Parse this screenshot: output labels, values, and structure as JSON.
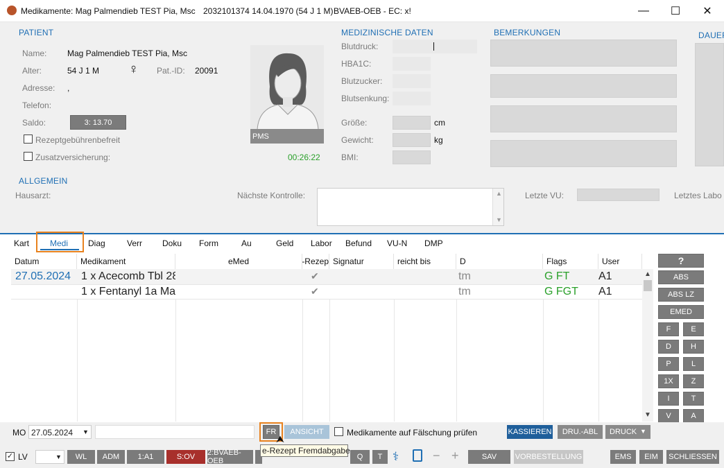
{
  "window": {
    "title": "Medikamente: Mag Palmendieb TEST Pia, Msc",
    "patient_info": "2032101374 14.04.1970 (54 J 1 M)",
    "insurance": "BVAEB-OEB - EC: x!",
    "minimize": "—",
    "maximize": "☐",
    "close": "✕"
  },
  "patient": {
    "section_title": "PATIENT",
    "name_label": "Name:",
    "name_value": "Mag Palmendieb TEST Pia, Msc",
    "age_label": "Alter:",
    "age_value": "54 J 1 M",
    "gender_symbol": "♀",
    "patid_label": "Pat.-ID:",
    "patid_value": "20091",
    "address_label": "Adresse:",
    "address_value": ",",
    "phone_label": "Telefon:",
    "saldo_label": "Saldo:",
    "saldo_value": "3: 13.70",
    "rezept_label": "Rezeptgebührenbefreit",
    "zusatz_label": "Zusatzversicherung:",
    "photo_caption": "PMS",
    "timer": "00:26:22"
  },
  "medical": {
    "section_title": "MEDIZINISCHE DATEN",
    "blutdruck": "Blutdruck:",
    "hba1c": "HBA1C:",
    "blutzucker": "Blutzucker:",
    "blutsenkung": "Blutsenkung:",
    "groesse": "Größe:",
    "groesse_unit": "cm",
    "gewicht": "Gewicht:",
    "gewicht_unit": "kg",
    "bmi": "BMI:"
  },
  "remarks": {
    "section_title": "BEMERKUNGEN"
  },
  "dauer": {
    "section_title": "DAUER"
  },
  "allgemein": {
    "section_title": "ALLGEMEIN",
    "hausarzt": "Hausarzt:",
    "naechste_kontrolle": "Nächste Kontrolle:",
    "letzte_vu": "Letzte VU:",
    "letztes_labor": "Letztes Labo"
  },
  "tabs": [
    "Kart",
    "Medi",
    "Diag",
    "Verr",
    "Doku",
    "Form",
    "Au",
    "Geld",
    "Labor",
    "Befund",
    "VU-N",
    "DMP"
  ],
  "table": {
    "headers": [
      "Datum",
      "Medikament",
      "eMed",
      "e-Rezep",
      "Signatur",
      "reicht bis",
      "D",
      "Flags",
      "User"
    ],
    "rows": [
      {
        "datum": "27.05.2024",
        "medikament": "1 x Acecomb Tbl 28",
        "check": "✔",
        "d": "tm",
        "flags": "G FT",
        "user": "A1"
      },
      {
        "datum": "",
        "medikament": "1 x Fentanyl 1a Ma",
        "check": "✔",
        "d": "tm",
        "flags": "G FGT",
        "user": "A1"
      }
    ]
  },
  "side_buttons": {
    "help": "?",
    "abs": "ABS",
    "abs_lz": "ABS LZ",
    "emed": "EMED",
    "grid": [
      [
        "F",
        "E"
      ],
      [
        "D",
        "H"
      ],
      [
        "P",
        "L"
      ],
      [
        "1X",
        "Z"
      ],
      [
        "I",
        "T"
      ],
      [
        "V",
        "A"
      ]
    ]
  },
  "form_bar": {
    "mo_label": "MO",
    "date": "27.05.2024",
    "fr": "FR",
    "ansicht": "ANSICHT",
    "check_label": "Medikamente auf Fälschung prüfen",
    "kassieren": "KASSIEREN",
    "dru_abl": "DRU.-ABL",
    "druck": "DRUCK",
    "tooltip": "e-Rezept Fremdabgabe"
  },
  "bottom_bar": {
    "lv": "LV",
    "wl": "WL",
    "adm": "ADM",
    "a1": "1:A1",
    "sov": "S:OV",
    "bvaeb": "2:BVAEB-OEB",
    "q": "Q",
    "t": "T",
    "sav": "SAV",
    "vorbestellung": "VORBESTELLUNG",
    "ems": "EMS",
    "eim": "EIM",
    "schliessen": "SCHLIESSEN"
  },
  "colors": {
    "accent": "#1f6fb4",
    "highlight": "#e8821e",
    "green": "#2aa02a",
    "danger": "#a8302c"
  }
}
